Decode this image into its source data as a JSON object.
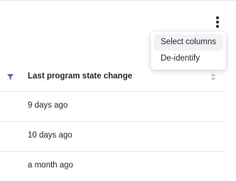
{
  "toolbar": {
    "more_icon": "vertical-ellipsis-icon"
  },
  "menu": {
    "items": [
      {
        "label": "Select columns"
      },
      {
        "label": "De-identify"
      }
    ]
  },
  "table": {
    "header": {
      "filter_icon": "filter-icon",
      "filter_color": "#7b4bb8",
      "label": "Last program state change",
      "sort_icon": "sort-icon"
    },
    "rows": [
      {
        "last_program_state_change": "9 days ago"
      },
      {
        "last_program_state_change": "10 days ago"
      },
      {
        "last_program_state_change": "a month ago"
      }
    ]
  }
}
